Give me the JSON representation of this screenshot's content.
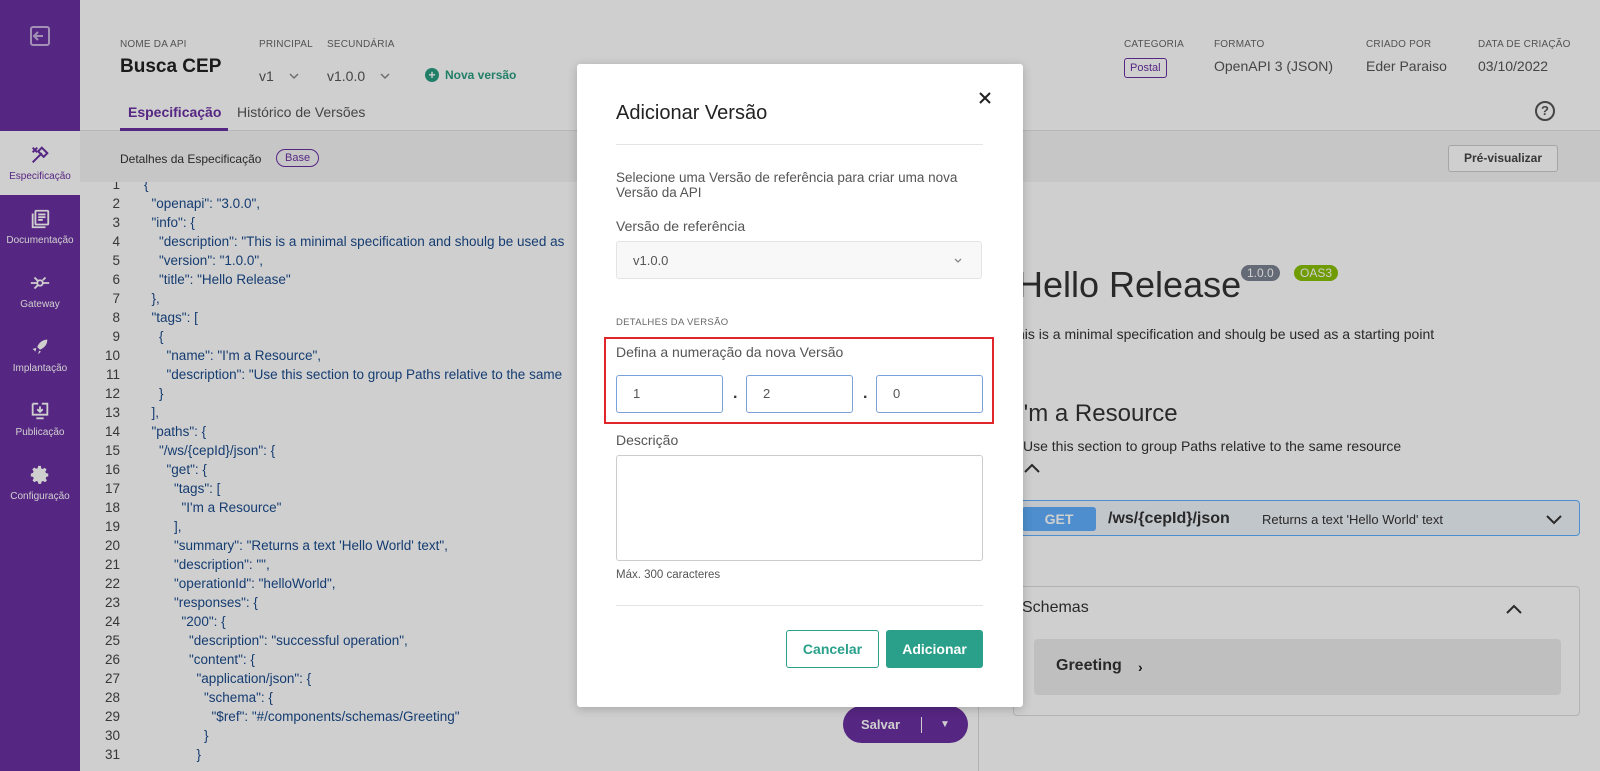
{
  "sidebar": {
    "items": [
      {
        "label": "Especificação",
        "icon": "tools-icon",
        "active": true
      },
      {
        "label": "Documentação",
        "icon": "book-icon",
        "active": false
      },
      {
        "label": "Gateway",
        "icon": "gateway-icon",
        "active": false
      },
      {
        "label": "Implantação",
        "icon": "rocket-icon",
        "active": false
      },
      {
        "label": "Publicação",
        "icon": "publish-icon",
        "active": false
      },
      {
        "label": "Configuração",
        "icon": "gear-icon",
        "active": false
      }
    ]
  },
  "header": {
    "api_name_label": "NOME DA API",
    "api_name": "Busca CEP",
    "principal_label": "PRINCIPAL",
    "principal_value": "v1",
    "secundaria_label": "SECUNDÁRIA",
    "secundaria_value": "v1.0.0",
    "nova_versao": "Nova versão",
    "categoria_label": "CATEGORIA",
    "categoria_value": "Postal",
    "formato_label": "FORMATO",
    "formato_value": "OpenAPI 3 (JSON)",
    "criado_por_label": "CRIADO POR",
    "criado_por_value": "Eder Paraiso",
    "data_label": "DATA DE CRIAÇÃO",
    "data_value": "03/10/2022",
    "tabs": [
      {
        "label": "Especificação",
        "active": true
      },
      {
        "label": "Histórico de Versões",
        "active": false
      }
    ],
    "help": "?"
  },
  "subbar": {
    "label": "Detalhes da Especificação",
    "pill": "Base",
    "preview_button": "Pré-visualizar"
  },
  "editor": {
    "lines": [
      "{",
      "  \"openapi\": \"3.0.0\",",
      "  \"info\": {",
      "    \"description\": \"This is a minimal specification and shoulg be used as",
      "    \"version\": \"1.0.0\",",
      "    \"title\": \"Hello Release\"",
      "  },",
      "  \"tags\": [",
      "    {",
      "      \"name\": \"I'm a Resource\",",
      "      \"description\": \"Use this section to group Paths relative to the same",
      "    }",
      "  ],",
      "  \"paths\": {",
      "    \"/ws/{cepId}/json\": {",
      "      \"get\": {",
      "        \"tags\": [",
      "          \"I'm a Resource\"",
      "        ],",
      "        \"summary\": \"Returns a text 'Hello World' text\",",
      "        \"description\": \"\",",
      "        \"operationId\": \"helloWorld\",",
      "        \"responses\": {",
      "          \"200\": {",
      "            \"description\": \"successful operation\",",
      "            \"content\": {",
      "              \"application/json\": {",
      "                \"schema\": {",
      "                  \"$ref\": \"#/components/schemas/Greeting\"",
      "                }",
      "              }"
    ],
    "save_label": "Salvar"
  },
  "preview": {
    "title": "Hello Release",
    "version_badge": "1.0.0",
    "oas_badge": "OAS3",
    "description": "his is a minimal specification and shoulg be used as a starting point",
    "resource_title": "I'm a Resource",
    "resource_desc": "Use this section to group Paths relative to the same resource",
    "method": "GET",
    "path": "/ws/{cepId}/json",
    "summary": "Returns a text 'Hello World' text",
    "schemas_title": "Schemas",
    "schema_item": "Greeting"
  },
  "modal": {
    "title": "Adicionar Versão",
    "info": "Selecione uma Versão de referência para criar uma nova Versão da API",
    "ref_label": "Versão de referência",
    "ref_value": "v1.0.0",
    "section_label": "DETALHES DA VERSÃO",
    "define_label": "Defina a numeração da nova Versão",
    "major": "1",
    "minor": "2",
    "patch": "0",
    "dot": ".",
    "desc_label": "Descrição",
    "max_label": "Máx. 300 caracteres",
    "cancel": "Cancelar",
    "add": "Adicionar"
  },
  "colors": {
    "sidebar": "#6b2fa2",
    "accent_green": "#2aa08a",
    "highlight_red": "#e0262b",
    "get_blue": "#61affe"
  }
}
